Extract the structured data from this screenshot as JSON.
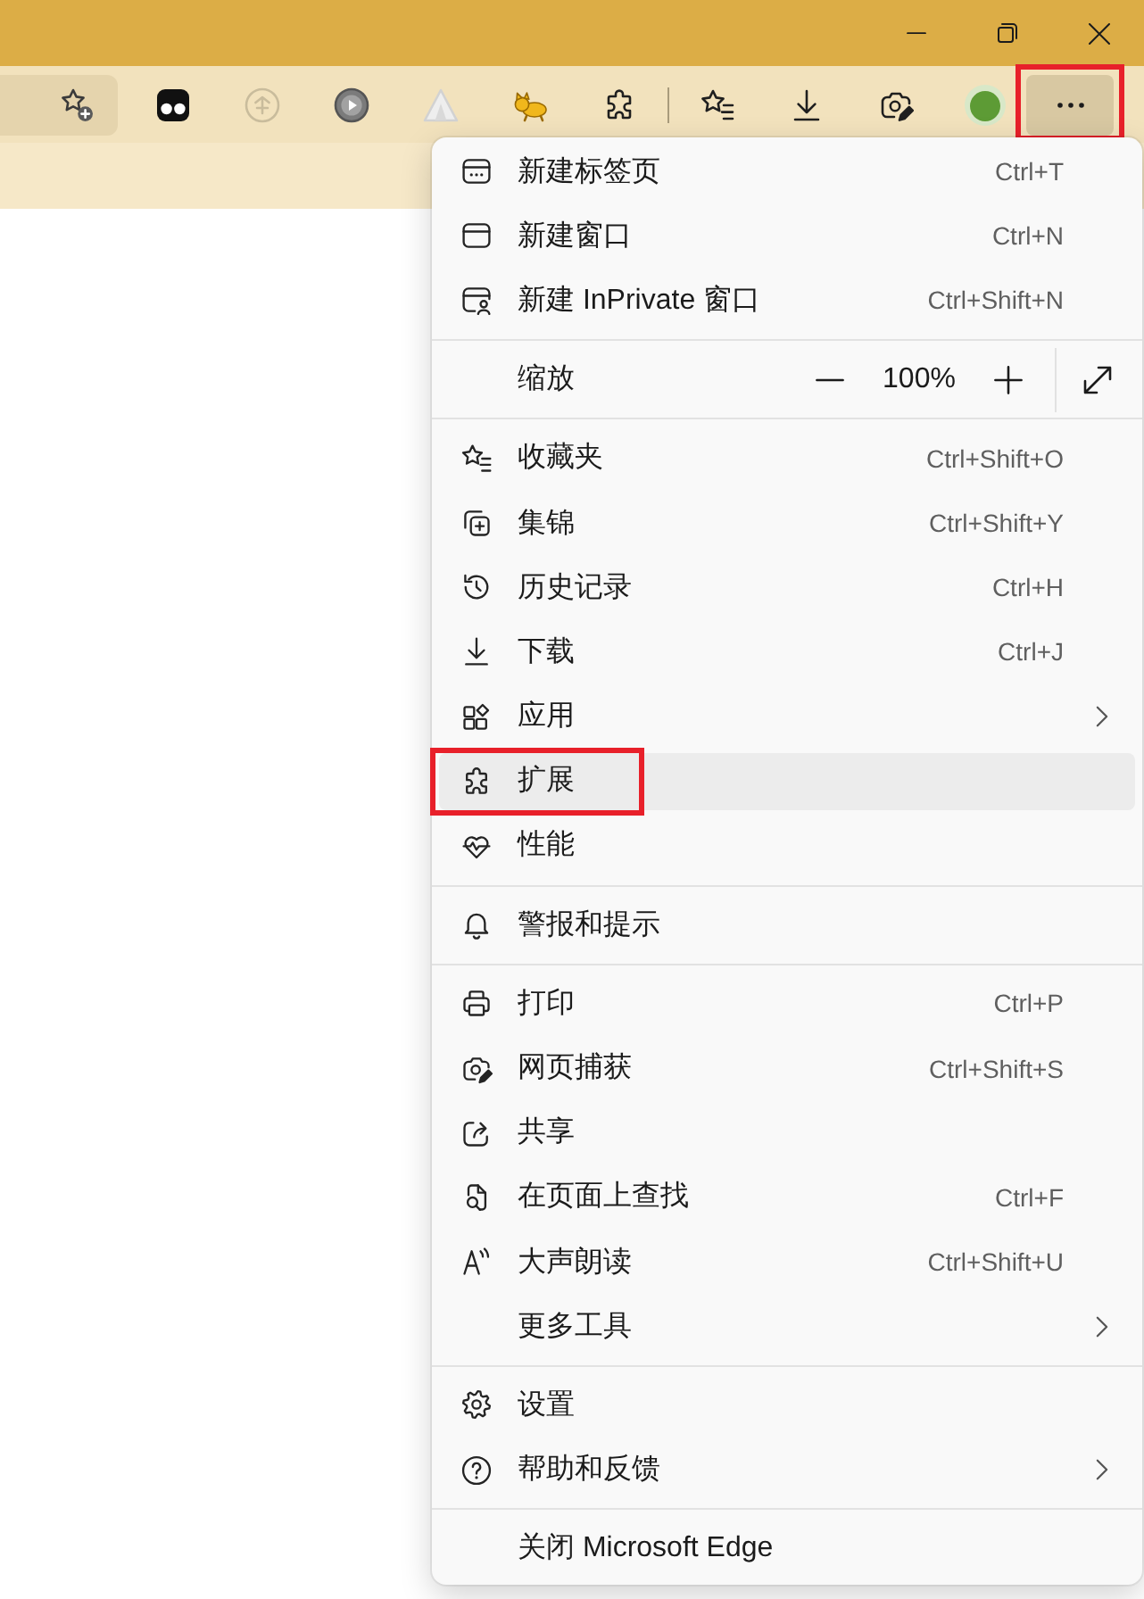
{
  "toolbar": {
    "more_button": {
      "pressed": true,
      "highlighted": true
    }
  },
  "menu": {
    "groups": [
      {
        "kind": "items",
        "items": [
          {
            "kind": "command",
            "label": "新建标签页",
            "shortcut": "Ctrl+T",
            "hovered": false,
            "highlighted": false
          },
          {
            "kind": "command",
            "label": "新建窗口",
            "shortcut": "Ctrl+N",
            "hovered": false,
            "highlighted": false
          },
          {
            "kind": "command",
            "label": "新建 InPrivate 窗口",
            "shortcut": "Ctrl+Shift+N",
            "hovered": false,
            "highlighted": false
          }
        ]
      },
      {
        "kind": "zoom",
        "label": "缩放",
        "value": "100%"
      },
      {
        "kind": "items",
        "items": [
          {
            "kind": "command",
            "label": "收藏夹",
            "shortcut": "Ctrl+Shift+O",
            "hovered": false,
            "highlighted": false
          },
          {
            "kind": "command",
            "label": "集锦",
            "shortcut": "Ctrl+Shift+Y",
            "hovered": false,
            "highlighted": false
          },
          {
            "kind": "command",
            "label": "历史记录",
            "shortcut": "Ctrl+H",
            "hovered": false,
            "highlighted": false
          },
          {
            "kind": "command",
            "label": "下载",
            "shortcut": "Ctrl+J",
            "hovered": false,
            "highlighted": false
          },
          {
            "kind": "submenu",
            "label": "应用",
            "hovered": false,
            "highlighted": false
          },
          {
            "kind": "command",
            "label": "扩展",
            "hovered": true,
            "highlighted": true
          },
          {
            "kind": "command",
            "label": "性能",
            "hovered": false,
            "highlighted": false
          }
        ]
      },
      {
        "kind": "items",
        "items": [
          {
            "kind": "command",
            "label": "警报和提示",
            "hovered": false,
            "highlighted": false
          }
        ]
      },
      {
        "kind": "items",
        "items": [
          {
            "kind": "command",
            "label": "打印",
            "shortcut": "Ctrl+P",
            "hovered": false,
            "highlighted": false
          },
          {
            "kind": "command",
            "label": "网页捕获",
            "shortcut": "Ctrl+Shift+S",
            "hovered": false,
            "highlighted": false
          },
          {
            "kind": "command",
            "label": "共享",
            "hovered": false,
            "highlighted": false
          },
          {
            "kind": "command",
            "label": "在页面上查找",
            "shortcut": "Ctrl+F",
            "hovered": false,
            "highlighted": false
          },
          {
            "kind": "command",
            "label": "大声朗读",
            "shortcut": "Ctrl+Shift+U",
            "hovered": false,
            "highlighted": false
          },
          {
            "kind": "submenu",
            "label": "更多工具",
            "hovered": false,
            "highlighted": false
          }
        ]
      },
      {
        "kind": "items",
        "items": [
          {
            "kind": "command",
            "label": "设置",
            "hovered": false,
            "highlighted": false
          },
          {
            "kind": "submenu",
            "label": "帮助和反馈",
            "hovered": false,
            "highlighted": false
          }
        ]
      },
      {
        "kind": "items",
        "items": [
          {
            "kind": "command",
            "label": "关闭 Microsoft Edge",
            "hovered": false,
            "highlighted": false
          }
        ]
      }
    ]
  }
}
